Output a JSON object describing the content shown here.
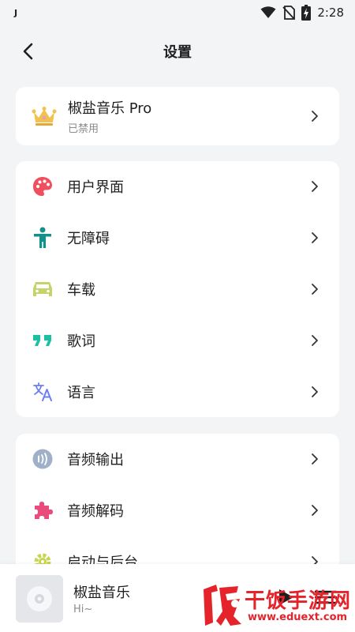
{
  "status_bar": {
    "notification_glyph": "J",
    "time": "2:28"
  },
  "app_bar": {
    "title": "设置"
  },
  "pro_card": {
    "title": "椒盐音乐 Pro",
    "subtitle": "已禁用",
    "icon": "crown-icon"
  },
  "settings_group_1": [
    {
      "label": "用户界面",
      "icon": "palette-icon",
      "color": "#f0505e"
    },
    {
      "label": "无障碍",
      "icon": "accessibility-icon",
      "color": "#14908a"
    },
    {
      "label": "车载",
      "icon": "car-icon",
      "color": "#c5d36a"
    },
    {
      "label": "歌词",
      "icon": "quote-icon",
      "color": "#19c0a1"
    },
    {
      "label": "语言",
      "icon": "translate-icon",
      "color": "#6c7ef2"
    }
  ],
  "settings_group_2": [
    {
      "label": "音频输出",
      "icon": "speaker-icon",
      "color": "#9fb0c8"
    },
    {
      "label": "音频解码",
      "icon": "puzzle-icon",
      "color": "#e94b7c"
    },
    {
      "label": "启动与后台",
      "icon": "gear-icon",
      "color": "#c9d54d"
    }
  ],
  "player": {
    "title": "椒盐音乐",
    "subtitle": "Hi~"
  },
  "watermark": {
    "main": "干饭手游网",
    "url": "www.eduext.com"
  }
}
